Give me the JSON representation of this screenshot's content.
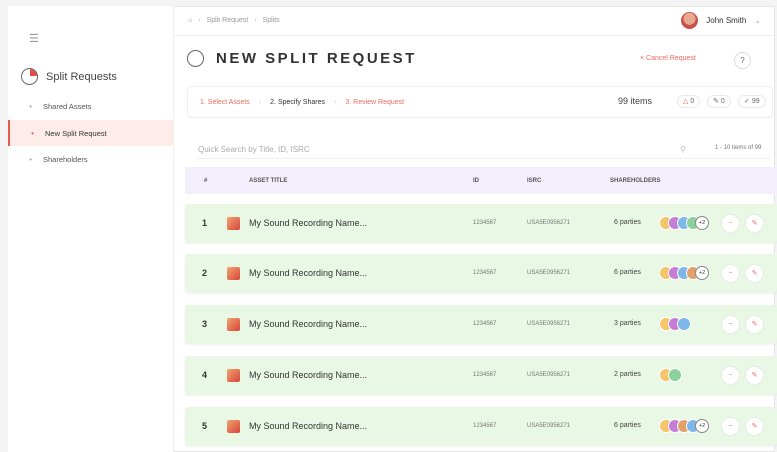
{
  "breadcrumb": [
    "Split Request",
    "Splits"
  ],
  "user": {
    "name": "John Smith"
  },
  "sidebar": {
    "title": "Split Requests",
    "items": [
      {
        "label": "Shared Assets",
        "active": false
      },
      {
        "label": "New Split Request",
        "active": true
      },
      {
        "label": "Shareholders",
        "active": false
      }
    ]
  },
  "header": {
    "title": "NEW SPLIT REQUEST",
    "cancel_label": "× Cancel Request",
    "help_label": "?"
  },
  "steps": [
    {
      "label": "1. Select Assets",
      "state": "done"
    },
    {
      "label": "2. Specify Shares",
      "state": "current"
    },
    {
      "label": "3. Review Request",
      "state": "todo"
    }
  ],
  "summary": {
    "items_label": "99 items",
    "warnings": "0",
    "edits": "0",
    "checks": "99"
  },
  "search": {
    "placeholder": "Quick Search by Title, ID, ISRC",
    "paging": "1 - 10 items of 99"
  },
  "table": {
    "headers": {
      "num": "#",
      "title": "ASSET TITLE",
      "id": "ID",
      "isrc": "ISRC",
      "shareholders": "SHAREHOLDERS"
    },
    "rows": [
      {
        "num": "1",
        "title": "My Sound Recording Name...",
        "id": "1234567",
        "isrc": "USA5E0956271",
        "parties": "6 parties",
        "avatars": [
          "#f4c56a",
          "#c67dd6",
          "#7db8e8",
          "#8ad19c"
        ],
        "more": "+2"
      },
      {
        "num": "2",
        "title": "My Sound Recording Name...",
        "id": "1234567",
        "isrc": "USA5E0956271",
        "parties": "6 parties",
        "avatars": [
          "#f4c56a",
          "#c67dd6",
          "#7db8e8",
          "#e3a06a"
        ],
        "more": "+2"
      },
      {
        "num": "3",
        "title": "My Sound Recording Name...",
        "id": "1234567",
        "isrc": "USA5E0956271",
        "parties": "3 parties",
        "avatars": [
          "#f4c56a",
          "#c67dd6",
          "#7db8e8"
        ],
        "more": ""
      },
      {
        "num": "4",
        "title": "My Sound Recording Name...",
        "id": "1234567",
        "isrc": "USA5E0956271",
        "parties": "2 parties",
        "avatars": [
          "#f4c56a",
          "#8ad19c"
        ],
        "more": ""
      },
      {
        "num": "5",
        "title": "My Sound Recording Name...",
        "id": "1234567",
        "isrc": "USA5E0956271",
        "parties": "6 parties",
        "avatars": [
          "#f4c56a",
          "#c67dd6",
          "#e3a06a",
          "#7db8e8"
        ],
        "more": "+2"
      }
    ]
  },
  "icons": {
    "menu": "hamburger-icon",
    "home": "home-icon",
    "remove": "remove-icon",
    "edit": "edit-icon",
    "search": "search-icon"
  }
}
